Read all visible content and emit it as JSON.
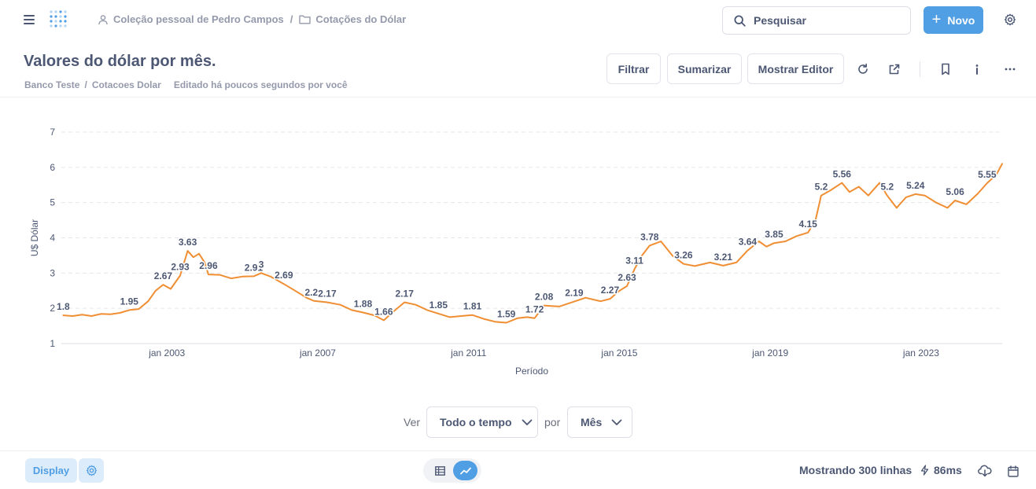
{
  "nav": {
    "breadcrumb": [
      "Coleção pessoal de Pedro Campos",
      "Cotações do Dólar"
    ],
    "search_placeholder": "Pesquisar",
    "new_label": "Novo"
  },
  "header": {
    "title": "Valores do dólar por mês.",
    "database": "Banco Teste",
    "table": "Cotacoes Dolar",
    "edited": "Editado há poucos segundos por você",
    "filter_label": "Filtrar",
    "summarize_label": "Sumarizar",
    "editor_label": "Mostrar Editor"
  },
  "controls": {
    "ver_label": "Ver",
    "range_value": "Todo o tempo",
    "por_label": "por",
    "unit_value": "Mês"
  },
  "footer": {
    "display_label": "Display",
    "rows_label": "Mostrando 300 linhas",
    "timing": "86ms"
  },
  "colors": {
    "accent": "#509ee3",
    "line": "#f08e33"
  },
  "chart_data": {
    "type": "line",
    "title": "",
    "xlabel": "Período",
    "ylabel": "U$ Dólar",
    "ylim": [
      1,
      7
    ],
    "yticks": [
      1,
      2,
      3,
      4,
      5,
      6,
      7
    ],
    "xticks": [
      "jan 2003",
      "jan 2007",
      "jan 2011",
      "jan 2015",
      "jan 2019",
      "jan 2023"
    ],
    "xtick_years": [
      2003,
      2007,
      2011,
      2015,
      2019,
      2023
    ],
    "xlim": [
      2000.2,
      2025.15
    ],
    "grid": true,
    "series": [
      {
        "color": "#f08e33",
        "points": [
          [
            2000.25,
            1.8
          ],
          [
            2000.5,
            1.78
          ],
          [
            2000.75,
            1.82
          ],
          [
            2001.0,
            1.78
          ],
          [
            2001.25,
            1.84
          ],
          [
            2001.5,
            1.83
          ],
          [
            2001.75,
            1.87
          ],
          [
            2002.0,
            1.95
          ],
          [
            2002.25,
            1.98
          ],
          [
            2002.5,
            2.2
          ],
          [
            2002.7,
            2.5
          ],
          [
            2002.9,
            2.67
          ],
          [
            2003.1,
            2.55
          ],
          [
            2003.35,
            2.93
          ],
          [
            2003.55,
            3.63
          ],
          [
            2003.7,
            3.45
          ],
          [
            2003.85,
            3.55
          ],
          [
            2004.0,
            3.3
          ],
          [
            2004.1,
            2.96
          ],
          [
            2004.4,
            2.95
          ],
          [
            2004.7,
            2.85
          ],
          [
            2005.0,
            2.9
          ],
          [
            2005.3,
            2.91
          ],
          [
            2005.5,
            3.0
          ],
          [
            2005.75,
            2.9
          ],
          [
            2006.1,
            2.69
          ],
          [
            2006.4,
            2.5
          ],
          [
            2006.7,
            2.3
          ],
          [
            2006.9,
            2.21
          ],
          [
            2007.25,
            2.17
          ],
          [
            2007.6,
            2.1
          ],
          [
            2007.9,
            1.95
          ],
          [
            2008.2,
            1.88
          ],
          [
            2008.5,
            1.8
          ],
          [
            2008.75,
            1.66
          ],
          [
            2009.0,
            1.9
          ],
          [
            2009.3,
            2.17
          ],
          [
            2009.6,
            2.1
          ],
          [
            2009.9,
            1.95
          ],
          [
            2010.2,
            1.85
          ],
          [
            2010.5,
            1.75
          ],
          [
            2010.8,
            1.78
          ],
          [
            2011.1,
            1.81
          ],
          [
            2011.4,
            1.7
          ],
          [
            2011.7,
            1.62
          ],
          [
            2012.0,
            1.59
          ],
          [
            2012.3,
            1.72
          ],
          [
            2012.55,
            1.75
          ],
          [
            2012.75,
            1.72
          ],
          [
            2013.0,
            2.08
          ],
          [
            2013.4,
            2.05
          ],
          [
            2013.8,
            2.19
          ],
          [
            2014.1,
            2.3
          ],
          [
            2014.5,
            2.2
          ],
          [
            2014.75,
            2.27
          ],
          [
            2015.0,
            2.5
          ],
          [
            2015.2,
            2.63
          ],
          [
            2015.4,
            3.11
          ],
          [
            2015.6,
            3.5
          ],
          [
            2015.8,
            3.78
          ],
          [
            2016.1,
            3.9
          ],
          [
            2016.4,
            3.5
          ],
          [
            2016.7,
            3.26
          ],
          [
            2017.0,
            3.2
          ],
          [
            2017.4,
            3.3
          ],
          [
            2017.75,
            3.21
          ],
          [
            2018.1,
            3.3
          ],
          [
            2018.4,
            3.64
          ],
          [
            2018.7,
            3.9
          ],
          [
            2018.9,
            3.75
          ],
          [
            2019.1,
            3.85
          ],
          [
            2019.4,
            3.9
          ],
          [
            2019.7,
            4.05
          ],
          [
            2020.0,
            4.15
          ],
          [
            2020.2,
            4.5
          ],
          [
            2020.35,
            5.2
          ],
          [
            2020.6,
            5.35
          ],
          [
            2020.9,
            5.56
          ],
          [
            2021.1,
            5.3
          ],
          [
            2021.35,
            5.45
          ],
          [
            2021.6,
            5.2
          ],
          [
            2021.9,
            5.56
          ],
          [
            2022.1,
            5.2
          ],
          [
            2022.35,
            4.85
          ],
          [
            2022.6,
            5.15
          ],
          [
            2022.85,
            5.24
          ],
          [
            2023.1,
            5.2
          ],
          [
            2023.4,
            5.0
          ],
          [
            2023.7,
            4.85
          ],
          [
            2023.9,
            5.06
          ],
          [
            2024.2,
            4.95
          ],
          [
            2024.5,
            5.25
          ],
          [
            2024.75,
            5.55
          ],
          [
            2025.0,
            5.8
          ],
          [
            2025.15,
            6.1
          ]
        ]
      }
    ],
    "data_labels": [
      [
        2000.25,
        1.8,
        "1.8"
      ],
      [
        2002.0,
        1.95,
        "1.95"
      ],
      [
        2002.9,
        2.67,
        "2.67"
      ],
      [
        2003.35,
        2.93,
        "2.93"
      ],
      [
        2003.55,
        3.63,
        "3.63"
      ],
      [
        2004.1,
        2.96,
        "2.96"
      ],
      [
        2005.3,
        2.91,
        "2.91"
      ],
      [
        2005.5,
        3.0,
        "3"
      ],
      [
        2006.1,
        2.69,
        "2.69"
      ],
      [
        2006.9,
        2.21,
        "2.21"
      ],
      [
        2007.25,
        2.17,
        "2.17"
      ],
      [
        2008.2,
        1.88,
        "1.88"
      ],
      [
        2008.75,
        1.66,
        "1.66"
      ],
      [
        2009.3,
        2.17,
        "2.17"
      ],
      [
        2010.2,
        1.85,
        "1.85"
      ],
      [
        2011.1,
        1.81,
        "1.81"
      ],
      [
        2012.0,
        1.59,
        "1.59"
      ],
      [
        2012.75,
        1.72,
        "1.72"
      ],
      [
        2013.0,
        2.08,
        "2.08"
      ],
      [
        2013.8,
        2.19,
        "2.19"
      ],
      [
        2014.75,
        2.27,
        "2.27"
      ],
      [
        2015.2,
        2.63,
        "2.63"
      ],
      [
        2015.4,
        3.11,
        "3.11"
      ],
      [
        2015.8,
        3.78,
        "3.78"
      ],
      [
        2016.7,
        3.26,
        "3.26"
      ],
      [
        2017.75,
        3.21,
        "3.21"
      ],
      [
        2018.4,
        3.64,
        "3.64"
      ],
      [
        2019.1,
        3.85,
        "3.85"
      ],
      [
        2020.0,
        4.15,
        "4.15"
      ],
      [
        2020.35,
        5.2,
        "5.2"
      ],
      [
        2020.9,
        5.56,
        "5.56"
      ],
      [
        2022.1,
        5.2,
        "5.2"
      ],
      [
        2022.85,
        5.24,
        "5.24"
      ],
      [
        2023.9,
        5.06,
        "5.06"
      ],
      [
        2024.75,
        5.55,
        "5.55"
      ]
    ]
  }
}
